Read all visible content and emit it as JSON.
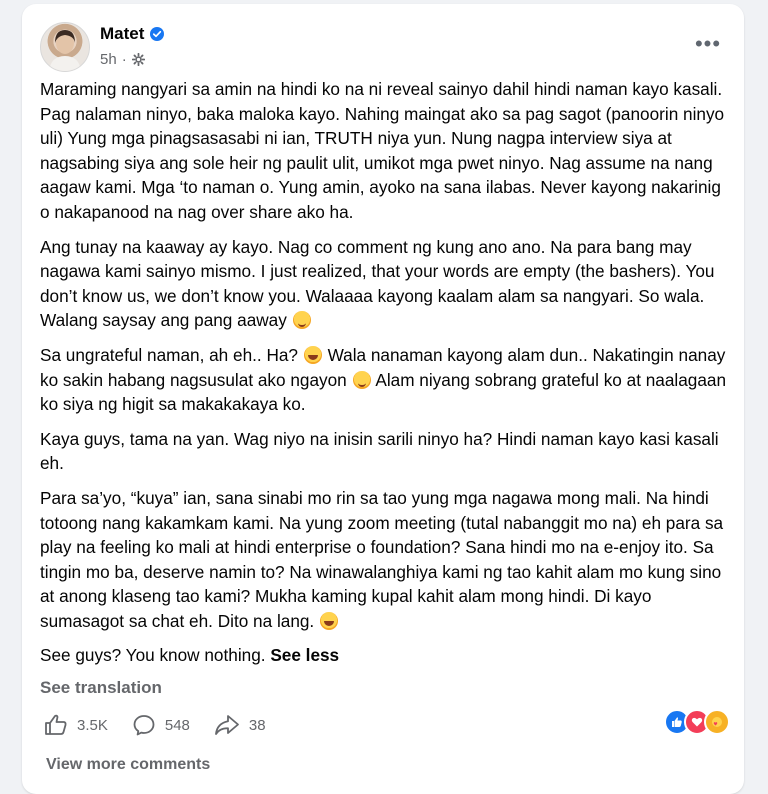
{
  "post": {
    "author": "Matet",
    "time": "5h",
    "paragraphs": [
      "Maraming nangyari sa amin na hindi ko na ni reveal sainyo dahil hindi naman kayo kasali. Pag nalaman ninyo, baka maloka kayo. Nahing maingat ako sa pag sagot (panoorin ninyo uli) Yung mga pinagsasasabi ni ian, TRUTH niya yun. Nung nagpa interview siya at nagsabing siya ang sole heir ng paulit ulit, umikot mga pwet ninyo. Nag assume na nang aagaw kami. Mga ‘to naman o. Yung amin, ayoko na sana ilabas. Never kayong nakarinig o nakapanood na nag over share ako ha.",
      "Ang tunay na kaaway ay kayo. Nag co comment ng kung ano ano. Na para bang may nagawa kami sainyo mismo. I just realized, that your words are empty (the bashers). You don’t know us, we don’t know you. Walaaaa kayong kaalam alam sa nangyari. So wala. Walang saysay ang pang aaway",
      "Sa ungrateful naman, ah eh.. Ha?",
      "Wala nanaman kayong alam dun.. Nakatingin nanay ko sakin habang nagsusulat ako ngayon",
      "Alam niyang sobrang grateful ko at naalagaan ko siya ng higit sa makakakaya ko.",
      "Kaya guys, tama na yan. Wag niyo na inisin sarili ninyo ha? Hindi naman kayo kasi kasali eh.",
      "Para sa’yo, “kuya” ian, sana sinabi mo rin sa tao yung mga nagawa mong mali. Na hindi totoong nang kakamkam kami. Na yung zoom meeting (tutal nabanggit mo na) eh para sa play na feeling ko mali at hindi enterprise o foundation? Sana hindi mo na e-enjoy ito. Sa tingin mo ba, deserve namin to? Na winawalanghiya kami ng tao kahit alam mo kung sino at anong klaseng tao kami? Mukha kaming kupal kahit alam mong hindi. Di kayo sumasagot sa chat eh. Dito na lang.",
      "See guys? You know nothing."
    ],
    "see_less": "See less",
    "see_translation": "See translation",
    "likes": "3.5K",
    "comments": "548",
    "shares": "38",
    "view_more_comments": "View more comments"
  },
  "icons": {
    "verified": "verified-badge-icon",
    "audience": "gear-icon",
    "more": "more-options-icon",
    "like": "thumbs-up-icon",
    "comment": "comment-bubble-icon",
    "share": "share-arrow-icon"
  },
  "colors": {
    "verified_blue": "#1877f2",
    "secondary_text": "#65676b",
    "like_blue": "#1877f2",
    "love_red": "#f33e58",
    "care_yellow": "#f7b125"
  }
}
